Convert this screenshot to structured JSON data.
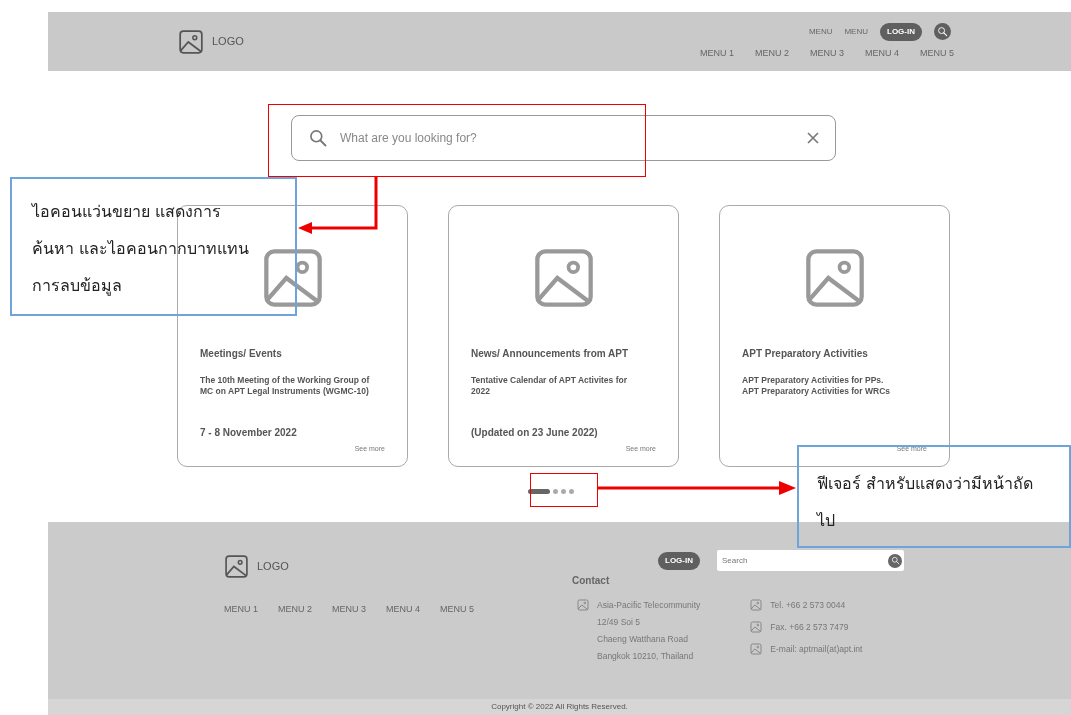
{
  "header": {
    "logo": "LOGO",
    "top_links": [
      "MENU",
      "MENU"
    ],
    "login": "LOG-IN",
    "menu": [
      "MENU 1",
      "MENU 2",
      "MENU 3",
      "MENU 4",
      "MENU 5"
    ]
  },
  "search": {
    "placeholder": "What are you looking for?"
  },
  "cards": [
    {
      "title": "Meetings/ Events",
      "body": "The 10th Meeting of the Working Group of MC on APT Legal Instruments (WGMC-10)",
      "date": "7 - 8 November 2022",
      "link": "See more"
    },
    {
      "title": "News/ Announcements from APT",
      "body": "Tentative Calendar of APT Activites for 2022",
      "date": "(Updated on 23 June 2022)",
      "link": "See more"
    },
    {
      "title": "APT Preparatory Activities",
      "body": "APT Preparatory Activities for PPs.\nAPT Preparatory Activities for WRCs",
      "link": "See more"
    }
  ],
  "carousel_dots": [
    {
      "selected": true
    },
    {
      "selected": false
    },
    {
      "selected": false
    },
    {
      "selected": false
    }
  ],
  "footer": {
    "logo": "LOGO",
    "login": "LOG-IN",
    "search_placeholder": "Search",
    "menu": [
      "MENU 1",
      "MENU 2",
      "MENU 3",
      "MENU 4",
      "MENU 5"
    ],
    "contact_heading": "Contact",
    "address": [
      "Asia-Pacific Telecommunity",
      "12/49 Soi 5",
      "Chaeng Watthana Road",
      "Bangkok 10210, Thailand"
    ],
    "contacts": [
      "Tel. +66 2 573 0044",
      "Fax. +66 2 573 7479",
      "E-mail: aptmail(at)apt.int"
    ],
    "copyright": "Copyright © 2022 All Rights Reserved."
  },
  "annotations": [
    {
      "text": "ไอคอนแว่นขยาย แสดงการค้นหา และไอคอนกากบาทแทนการลบข้อมูล"
    },
    {
      "text": "ฟีเจอร์ สำหรับแสดงว่ามีหน้าถัดไป"
    }
  ]
}
